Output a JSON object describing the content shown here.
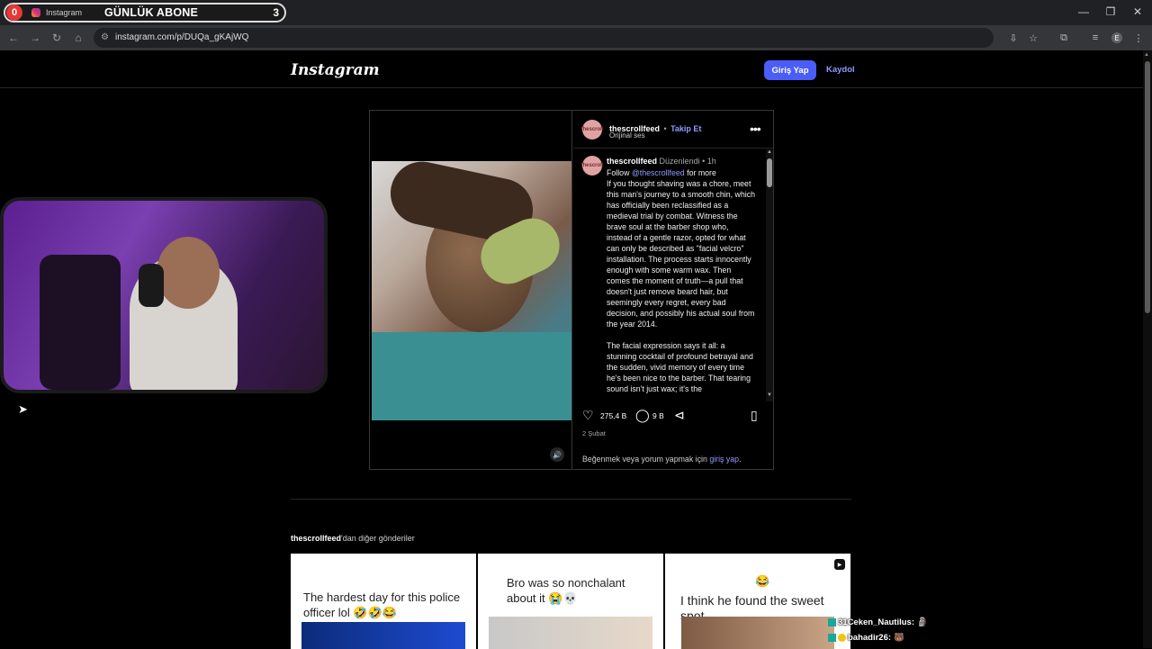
{
  "browser": {
    "tab_counter_left": "0",
    "tab_title": "Instagram",
    "tab_banner": "GÜNLÜK ABONE",
    "tab_counter_right": "3",
    "url": "instagram.com/p/DUQa_gKAjWQ",
    "profile_initial": "E"
  },
  "header": {
    "logo": "Instagram",
    "login_label": "Giriş Yap",
    "signup_label": "Kaydol"
  },
  "post": {
    "username": "thescrollfeed",
    "separator": "•",
    "follow_label": "Takip Et",
    "audio": "Orijinal ses",
    "avatar_text": "thescroll",
    "caption": {
      "username": "thescrollfeed",
      "edited": "Düzenlendi",
      "time": "1h",
      "line1_prefix": "Follow ",
      "mention": "@thescrollfeed",
      "line1_suffix": " for more",
      "paragraph1": "If you thought shaving was a chore, meet this man's journey to a smooth chin, which has officially been reclassified as a medieval trial by combat. Witness the brave soul at the barber shop who, instead of a gentle razor, opted for what can only be described as \"facial velcro\" installation. The process starts innocently enough with some warm wax. Then comes the moment of truth—a pull that doesn't just remove beard hair, but seemingly every regret, every bad decision, and possibly his actual soul from the year 2014.",
      "paragraph2": "The facial expression says it all: a stunning cocktail of profound betrayal and the sudden, vivid memory of every time he's been nice to the barber. That tearing sound isn't just wax; it's the"
    },
    "likes": "275,4 B",
    "comments": "9 B",
    "date": "2 Şubat",
    "login_note_prefix": "Beğenmek veya yorum yapmak için ",
    "login_note_link": "giriş yap",
    "login_note_suffix": "."
  },
  "more_posts": {
    "title_user": "thescrollfeed",
    "title_suffix": "'dan diğer gönderiler",
    "items": [
      {
        "text": "The hardest day for this police officer lol 🤣🤣😂"
      },
      {
        "text": "Bro was so nonchalant about it 😭💀"
      },
      {
        "emoji": "😂",
        "text": "I think he found the sweet spot"
      }
    ]
  },
  "chat": [
    {
      "user": "31Ceken_Nautilus:",
      "emote": "🗿"
    },
    {
      "user": "bahadir26:",
      "emote": "🐻"
    }
  ],
  "icons": {
    "heart": "heart-icon",
    "comment": "comment-icon",
    "share": "share-icon",
    "bookmark": "bookmark-icon",
    "more": "more-icon",
    "mute": "speaker-icon"
  },
  "colors": {
    "accent": "#4a5df9",
    "link": "#8f9bff",
    "background": "#000000"
  }
}
